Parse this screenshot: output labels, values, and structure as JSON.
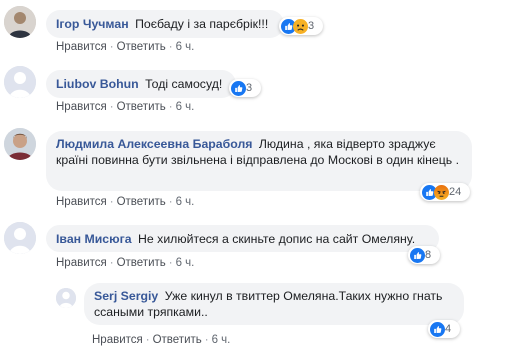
{
  "comments": [
    {
      "author": "Ігор Чучман",
      "text": "Поєбаду і за парєбрік!!!",
      "like": "Нравится",
      "reply": "Ответить",
      "time": "6 ч.",
      "reactions": [
        "like-icon",
        "sad-icon"
      ],
      "count": "3"
    },
    {
      "author": "Liubov Bohun",
      "text": "Тоді самосуд!",
      "like": "Нравится",
      "reply": "Ответить",
      "time": "6 ч.",
      "reactions": [
        "like-icon"
      ],
      "count": "3"
    },
    {
      "author": "Людмила Алексеевна Бараболя",
      "text": "Людина , яка відверто зраджує країні повинна бути звільнена і відправлена до Москові в один кінець .",
      "like": "Нравится",
      "reply": "Ответить",
      "time": "6 ч.",
      "reactions": [
        "like-icon",
        "angry-icon"
      ],
      "count": "24"
    },
    {
      "author": "Іван Мисюга",
      "text": "Не хилюйтеся а скиньте допис на сайт Омеляну.",
      "like": "Нравится",
      "reply": "Ответить",
      "time": "6 ч.",
      "reactions": [
        "like-icon"
      ],
      "count": "8"
    },
    {
      "author": "Serj Sergiy",
      "text": "Уже кинул в твиттер Омеляна.Таких нужно гнать ссаными тряпками..",
      "like": "Нравится",
      "reply": "Ответить",
      "time": "6 ч.",
      "reactions": [
        "like-icon"
      ],
      "count": "4"
    }
  ],
  "colors": {
    "author": "#385898",
    "bubble": "#f2f3f5",
    "like_blue": "#1877f2",
    "angry_red": "#e9710f"
  }
}
